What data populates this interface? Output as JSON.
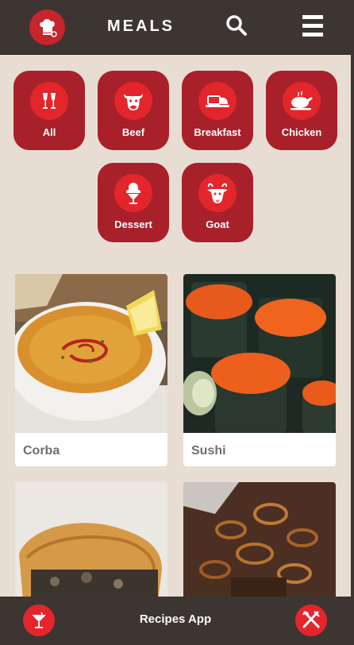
{
  "header": {
    "title": "MEALS",
    "logo_icon": "chef-hat-icon",
    "search_icon": "search-icon",
    "menu_icon": "hamburger-menu-icon"
  },
  "categories": [
    {
      "label": "All",
      "icon": "wine-glasses-icon"
    },
    {
      "label": "Beef",
      "icon": "cow-icon"
    },
    {
      "label": "Breakfast",
      "icon": "breakfast-plate-icon"
    },
    {
      "label": "Chicken",
      "icon": "roast-chicken-icon"
    },
    {
      "label": "Dessert",
      "icon": "ice-cream-icon"
    },
    {
      "label": "Goat",
      "icon": "goat-icon"
    }
  ],
  "meals": [
    {
      "name": "Corba"
    },
    {
      "name": "Sushi"
    },
    {
      "name": ""
    },
    {
      "name": ""
    }
  ],
  "bottom_bar": {
    "app_name": "Recipes App",
    "left_icon": "cocktail-icon",
    "right_icon": "fork-knife-icon"
  },
  "colors": {
    "header_bg": "#3d3532",
    "page_bg": "#e8ddd2",
    "category_bg": "#a8202a",
    "accent_red": "#e3262b"
  }
}
